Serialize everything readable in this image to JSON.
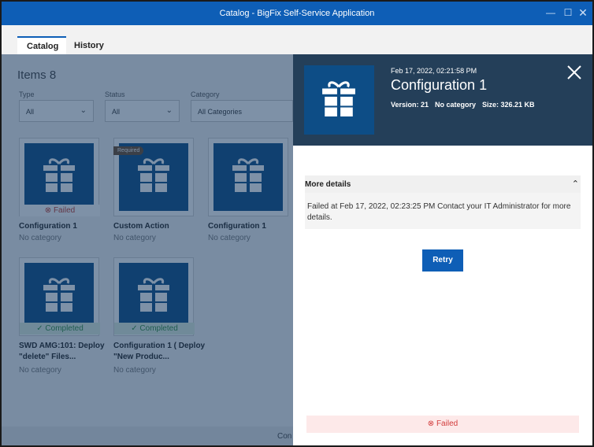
{
  "window": {
    "title": "Catalog - BigFix Self-Service Application"
  },
  "tabs": [
    {
      "label": "Catalog"
    },
    {
      "label": "History"
    }
  ],
  "catalog": {
    "items_title": "Items 8",
    "filters": [
      {
        "label": "Type",
        "value": "All"
      },
      {
        "label": "Status",
        "value": "All"
      },
      {
        "label": "Category",
        "value": "All Categories"
      }
    ],
    "cards": [
      {
        "name": "Configuration 1",
        "category": "No category",
        "status": "Failed",
        "badge": ""
      },
      {
        "name": "Custom Action",
        "category": "No category",
        "status": "",
        "badge": "Required"
      },
      {
        "name": "Configuration 1",
        "category": "No category",
        "status": "",
        "badge": ""
      },
      {
        "name": "SWD AMG:101: Deploy \"delete\" Files...",
        "category": "No category",
        "status": "Completed",
        "badge": ""
      },
      {
        "name": "Configuration 1 ( Deploy \"New Produc...",
        "category": "No category",
        "status": "Completed",
        "badge": ""
      }
    ],
    "bottom_text": "Con"
  },
  "panel": {
    "date": "Feb 17, 2022, 02:21:58 PM",
    "name": "Configuration 1",
    "version": "Version: 21",
    "category": "No category",
    "size": "Size: 326.21 KB",
    "more_details_title": "More details",
    "more_details_text": "Failed at Feb 17, 2022, 02:23:25 PM Contact your IT Administrator for more details.",
    "retry_label": "Retry",
    "footer_status": "Failed"
  },
  "colors": {
    "titlebar": "#0e5eb6",
    "panel_header": "#243f59",
    "tile": "#0d4d86",
    "retry": "#0e5eb6",
    "failed_text": "#d23b3b",
    "failed_bg": "#fde9e9",
    "completed_text": "#2e8b3d"
  }
}
